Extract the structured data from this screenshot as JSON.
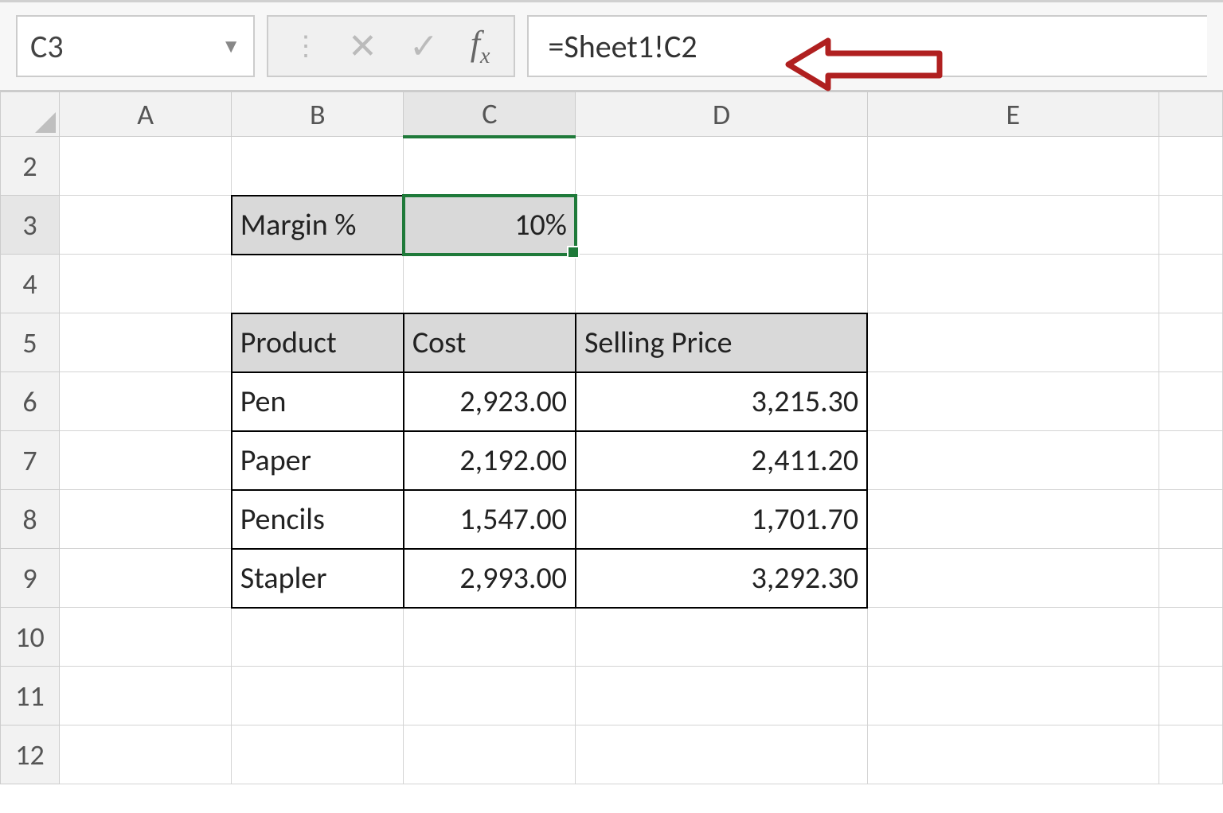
{
  "formula_bar": {
    "cell_ref": "C3",
    "formula": "=Sheet1!C2"
  },
  "columns": [
    "A",
    "B",
    "C",
    "D",
    "E"
  ],
  "rows_visible": [
    "2",
    "3",
    "4",
    "5",
    "6",
    "7",
    "8",
    "9",
    "10",
    "11",
    "12"
  ],
  "selected_column": "C",
  "selected_row": "3",
  "margin": {
    "label": "Margin %",
    "value": "10%"
  },
  "table": {
    "headers": {
      "product": "Product",
      "cost": "Cost",
      "price": "Selling Price"
    },
    "rows": [
      {
        "product": "Pen",
        "cost": "2,923.00",
        "price": "3,215.30"
      },
      {
        "product": "Paper",
        "cost": "2,192.00",
        "price": "2,411.20"
      },
      {
        "product": "Pencils",
        "cost": "1,547.00",
        "price": "1,701.70"
      },
      {
        "product": "Stapler",
        "cost": "2,993.00",
        "price": "3,292.30"
      }
    ]
  },
  "annotation": {
    "color": "#b02020"
  }
}
